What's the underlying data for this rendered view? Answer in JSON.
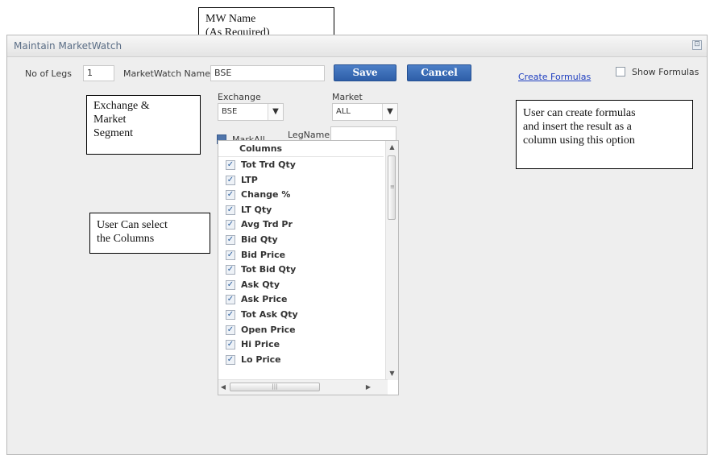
{
  "callouts": {
    "mw_name": {
      "line1": "MW Name",
      "line2": "(As Required)"
    },
    "exchange": {
      "line1": "Exchange &",
      "line2": "Market",
      "line3": "Segment"
    },
    "formulas": {
      "line1": "User can create formulas",
      "line2": "and insert the result as a",
      "line3": "column using this option"
    },
    "columns": {
      "line1": "User Can select",
      "line2": "the Columns"
    }
  },
  "dialog": {
    "title": "Maintain MarketWatch",
    "close_icon": "⊡",
    "no_of_legs_label": "No of Legs",
    "no_of_legs_value": "1",
    "mw_name_label": "MarketWatch Name",
    "mw_name_value": "BSE",
    "save_label": "Save",
    "cancel_label": "Cancel",
    "create_formulas_label": "Create Formulas",
    "show_formulas_label": "Show Formulas",
    "exchange_label": "Exchange",
    "exchange_value": "BSE",
    "market_label": "Market",
    "market_value": "ALL",
    "markall_label": "MarkAll",
    "legname_label": "LegName",
    "legname_value": ""
  },
  "columns_list": {
    "header": "Columns",
    "items": [
      "Tot Trd Qty",
      "LTP",
      "Change %",
      "LT Qty",
      "Avg Trd Pr",
      "Bid Qty",
      "Bid Price",
      "Tot Bid Qty",
      "Ask Qty",
      "Ask Price",
      "Tot Ask Qty",
      "Open Price",
      "Hi Price",
      "Lo Price"
    ]
  }
}
